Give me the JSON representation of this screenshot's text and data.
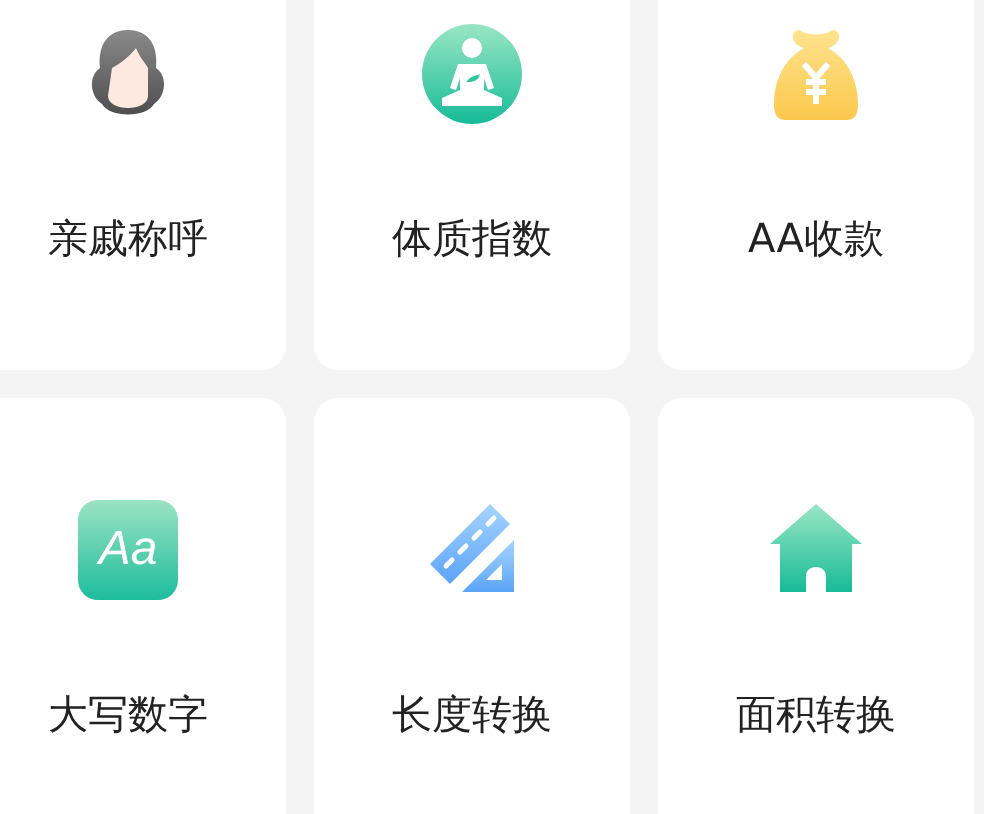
{
  "tools": [
    {
      "kind": "woman",
      "label": "亲戚称呼"
    },
    {
      "kind": "meditation",
      "label": "体质指数"
    },
    {
      "kind": "moneybag",
      "label": "AA收款"
    },
    {
      "kind": "letters",
      "icon_text": "Aa",
      "label": "大写数字"
    },
    {
      "kind": "ruler",
      "label": "长度转换"
    },
    {
      "kind": "house",
      "label": "面积转换"
    }
  ]
}
